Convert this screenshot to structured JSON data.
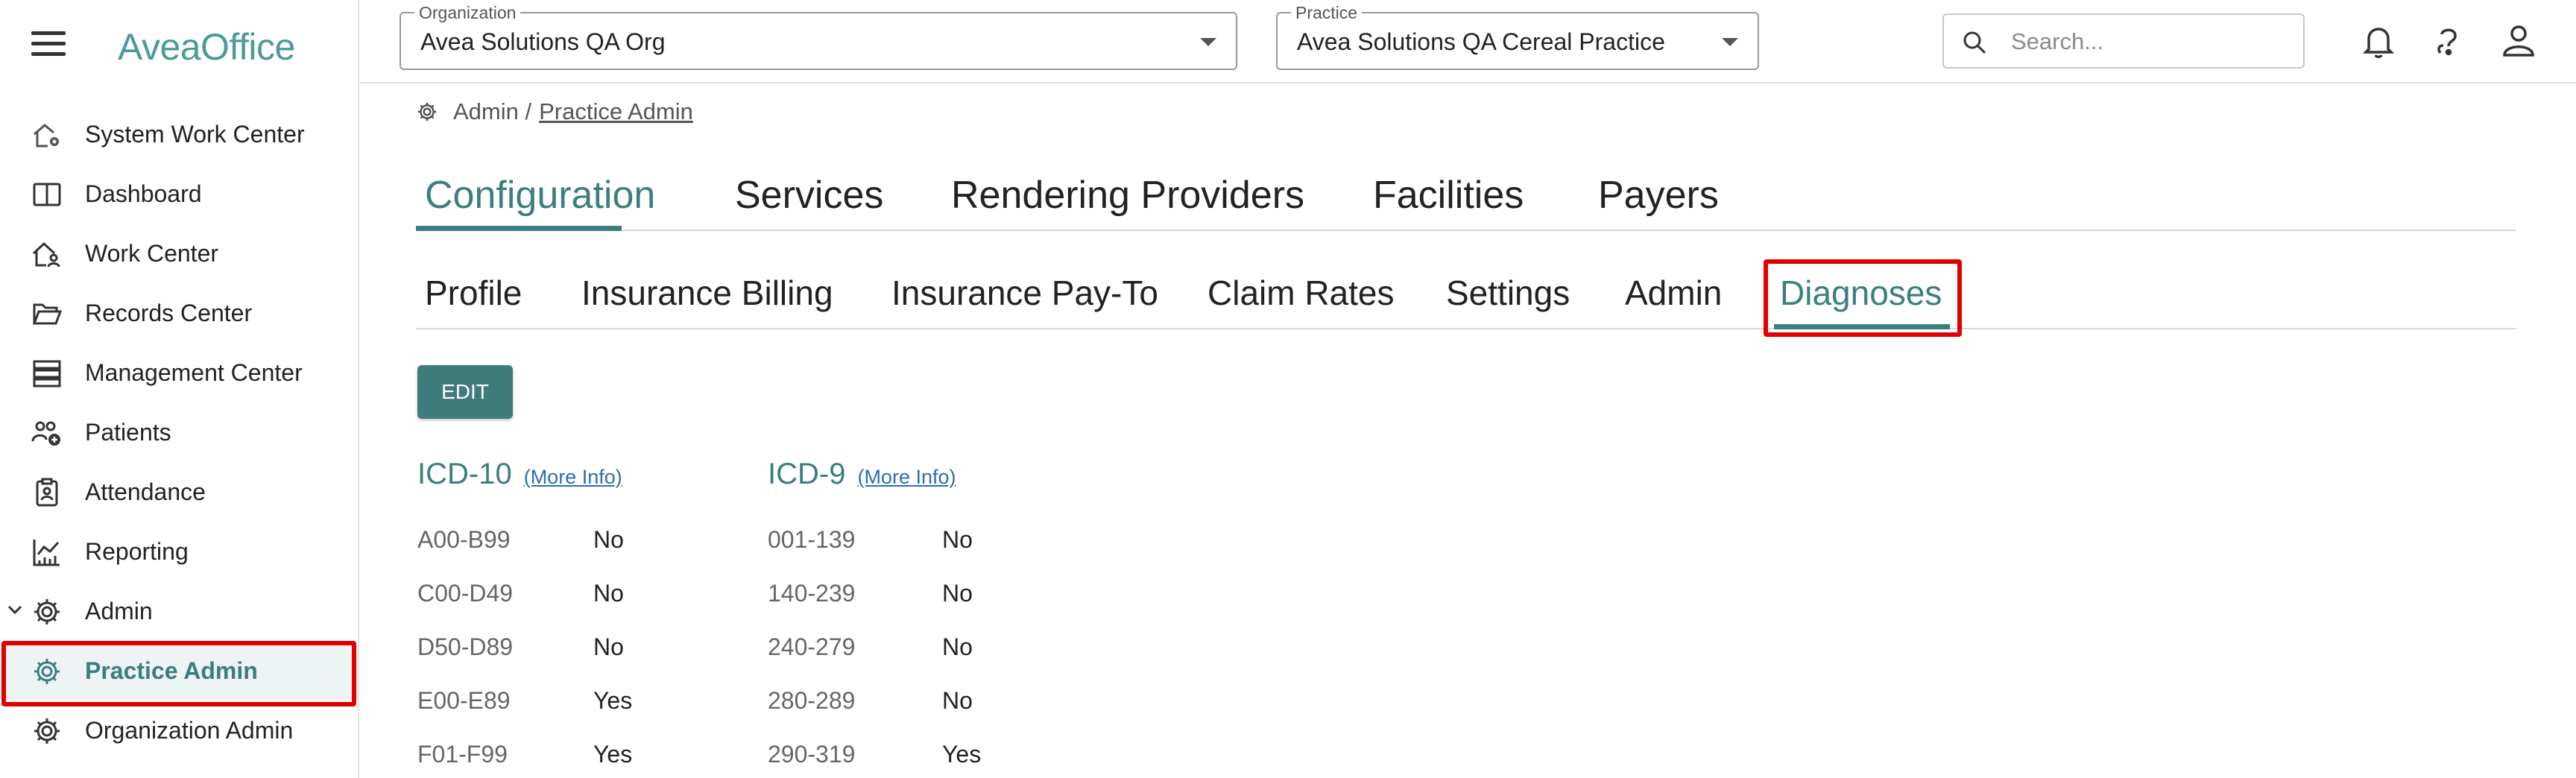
{
  "app": {
    "logo_text": "AveaOffice",
    "accent_color": "#3a7f7e",
    "highlight_color": "#e00000"
  },
  "sidebar": {
    "items": [
      {
        "label": "System Work Center",
        "icon": "house-gear-icon"
      },
      {
        "label": "Dashboard",
        "icon": "book-open-icon"
      },
      {
        "label": "Work Center",
        "icon": "house-person-icon"
      },
      {
        "label": "Records Center",
        "icon": "folder-open-icon"
      },
      {
        "label": "Management Center",
        "icon": "server-icon"
      },
      {
        "label": "Patients",
        "icon": "people-add-icon"
      },
      {
        "label": "Attendance",
        "icon": "clipboard-badge-icon"
      },
      {
        "label": "Reporting",
        "icon": "chart-icon"
      },
      {
        "label": "Admin",
        "icon": "gear-icon",
        "expanded": true
      },
      {
        "label": "Practice Admin",
        "icon": "gear-icon",
        "active": true
      },
      {
        "label": "Organization Admin",
        "icon": "gear-icon"
      }
    ]
  },
  "header": {
    "organization": {
      "legend": "Organization",
      "value": "Avea Solutions QA Org"
    },
    "practice": {
      "legend": "Practice",
      "value": "Avea Solutions QA Cereal Practice"
    },
    "search": {
      "placeholder": "Search..."
    },
    "icons": [
      "bell-icon",
      "help-icon",
      "user-icon"
    ]
  },
  "breadcrumb": {
    "root": "Admin /",
    "current": "Practice Admin"
  },
  "primary_tabs": [
    {
      "label": "Configuration",
      "active": true
    },
    {
      "label": "Services"
    },
    {
      "label": "Rendering Providers"
    },
    {
      "label": "Facilities"
    },
    {
      "label": "Payers"
    }
  ],
  "secondary_tabs": [
    {
      "label": "Profile"
    },
    {
      "label": "Insurance Billing"
    },
    {
      "label": "Insurance Pay-To"
    },
    {
      "label": "Claim Rates"
    },
    {
      "label": "Settings"
    },
    {
      "label": "Admin"
    },
    {
      "label": "Diagnoses",
      "active": true
    }
  ],
  "edit_label": "EDIT",
  "icd10": {
    "title": "ICD-10",
    "more": "(More Info)",
    "rows": [
      {
        "range": "A00-B99",
        "value": "No"
      },
      {
        "range": "C00-D49",
        "value": "No"
      },
      {
        "range": "D50-D89",
        "value": "No"
      },
      {
        "range": "E00-E89",
        "value": "Yes"
      },
      {
        "range": "F01-F99",
        "value": "Yes"
      }
    ]
  },
  "icd9": {
    "title": "ICD-9",
    "more": "(More Info)",
    "rows": [
      {
        "range": "001-139",
        "value": "No"
      },
      {
        "range": "140-239",
        "value": "No"
      },
      {
        "range": "240-279",
        "value": "No"
      },
      {
        "range": "280-289",
        "value": "No"
      },
      {
        "range": "290-319",
        "value": "Yes"
      }
    ]
  }
}
